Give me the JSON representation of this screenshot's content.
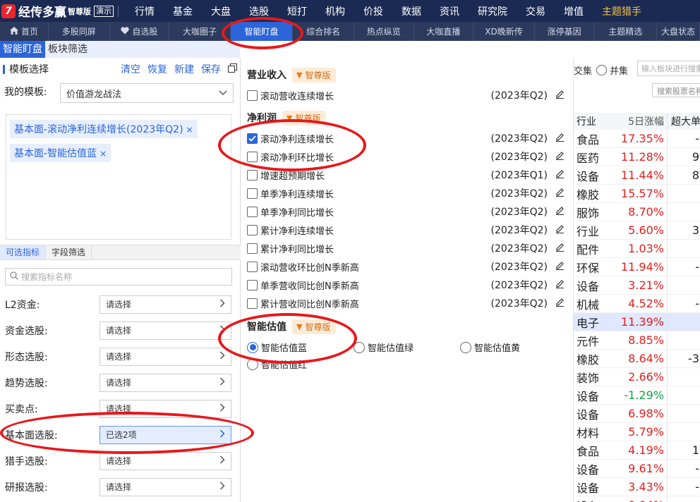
{
  "app": {
    "logo_text": "经传多赢",
    "logo_sub": "智尊版",
    "demo": "演示",
    "logo_mark": "7"
  },
  "top_menu": [
    {
      "label": "行情",
      "dot": false,
      "gold": false
    },
    {
      "label": "基金",
      "dot": false,
      "gold": false
    },
    {
      "label": "大盘",
      "dot": true,
      "gold": false
    },
    {
      "label": "选股",
      "dot": true,
      "gold": false
    },
    {
      "label": "短打",
      "dot": false,
      "gold": false
    },
    {
      "label": "机构",
      "dot": false,
      "gold": false
    },
    {
      "label": "价投",
      "dot": false,
      "gold": false
    },
    {
      "label": "数据",
      "dot": false,
      "gold": false
    },
    {
      "label": "资讯",
      "dot": false,
      "gold": false
    },
    {
      "label": "研究院",
      "dot": false,
      "gold": false
    },
    {
      "label": "交易",
      "dot": false,
      "gold": false
    },
    {
      "label": "增值",
      "dot": true,
      "gold": false
    },
    {
      "label": "主题猎手",
      "dot": false,
      "gold": true
    }
  ],
  "tabs": [
    {
      "label": "首页",
      "icon": "home-icon",
      "active": false
    },
    {
      "label": "多股同屏",
      "icon": "",
      "active": false
    },
    {
      "label": "自选股",
      "icon": "heart-icon",
      "active": false
    },
    {
      "label": "大咖圈子",
      "icon": "",
      "active": false
    },
    {
      "label": "智能盯盘",
      "icon": "",
      "active": true
    },
    {
      "label": "综合排名",
      "icon": "",
      "active": false
    },
    {
      "label": "热点纵览",
      "icon": "",
      "active": false
    },
    {
      "label": "大咖直播",
      "icon": "",
      "active": false
    },
    {
      "label": "XD晚新传",
      "icon": "",
      "active": false
    },
    {
      "label": "涨停基因",
      "icon": "",
      "active": false
    },
    {
      "label": "主题精选",
      "icon": "",
      "active": false
    },
    {
      "label": "大盘状态",
      "icon": "",
      "active": false
    }
  ],
  "side_tabs": [
    {
      "label": "智能盯盘",
      "active": true
    },
    {
      "label": "板块筛选",
      "active": false
    }
  ],
  "template": {
    "title": "模板选择",
    "actions": [
      "清空",
      "恢复",
      "新建",
      "保存"
    ],
    "my_label": "我的模板:",
    "selected": "价值游龙战法",
    "chips": [
      "基本面-滚动净利连续增长(2023年Q2)",
      "基本面-智能估值蓝"
    ],
    "chip_close": "×"
  },
  "subtabs": [
    {
      "label": "可选指标",
      "active": true
    },
    {
      "label": "字段筛选",
      "active": false
    }
  ],
  "search_placeholder": "搜索指标名称",
  "filters": [
    {
      "label": "L2资金:",
      "value": "请选择",
      "selected": false
    },
    {
      "label": "资金选股:",
      "value": "请选择",
      "selected": false
    },
    {
      "label": "形态选股:",
      "value": "请选择",
      "selected": false
    },
    {
      "label": "趋势选股:",
      "value": "请选择",
      "selected": false
    },
    {
      "label": "买卖点:",
      "value": "请选择",
      "selected": false
    },
    {
      "label": "基本面选股:",
      "value": "已选2项",
      "selected": true
    },
    {
      "label": "猎手选股:",
      "value": "请选择",
      "selected": false
    },
    {
      "label": "研报选股:",
      "value": "请选择",
      "selected": false
    }
  ],
  "mid": {
    "revenue_title": "营业收入",
    "badge": "智尊版",
    "revenue_items": [
      {
        "label": "滚动营收连续增长",
        "date": "(2023年Q2)",
        "checked": false
      }
    ],
    "profit_title": "净利润",
    "profit_items": [
      {
        "label": "滚动净利连续增长",
        "date": "(2023年Q2)",
        "checked": true
      },
      {
        "label": "滚动净利环比增长",
        "date": "(2023年Q2)",
        "checked": false
      },
      {
        "label": "增速超预期增长",
        "date": "(2023年Q1)",
        "checked": false
      },
      {
        "label": "单季净利连续增长",
        "date": "(2023年Q2)",
        "checked": false
      },
      {
        "label": "单季净利同比增长",
        "date": "(2023年Q2)",
        "checked": false
      },
      {
        "label": "累计净利连续增长",
        "date": "(2023年Q2)",
        "checked": false
      },
      {
        "label": "累计净利同比增长",
        "date": "(2023年Q2)",
        "checked": false
      },
      {
        "label": "滚动营收环比创N季新高",
        "date": "(2023年Q2)",
        "checked": false
      },
      {
        "label": "单季营收同比创N季新高",
        "date": "(2023年Q2)",
        "checked": false
      },
      {
        "label": "累计营收同比创N季新高",
        "date": "(2023年Q2)",
        "checked": false
      }
    ],
    "valuation_title": "智能估值",
    "valuation_items": [
      {
        "label": "智能估值蓝",
        "checked": true
      },
      {
        "label": "智能估值绿",
        "checked": false
      },
      {
        "label": "智能估值黄",
        "checked": false
      },
      {
        "label": "智能估值红",
        "checked": false
      }
    ]
  },
  "right": {
    "intersect": "交集",
    "union": "并集",
    "sector_search": "输入板块进行搜索",
    "stock_search": "搜索股票名称",
    "headers": [
      "行业",
      "5日涨幅",
      "超大单"
    ],
    "rows": [
      {
        "industry": "食品",
        "change": "17.35%",
        "dir": "up",
        "extra": "-"
      },
      {
        "industry": "医药",
        "change": "11.28%",
        "dir": "up",
        "extra": "9"
      },
      {
        "industry": "设备",
        "change": "11.44%",
        "dir": "up",
        "extra": "8"
      },
      {
        "industry": "橡胶",
        "change": "15.57%",
        "dir": "up",
        "extra": ""
      },
      {
        "industry": "服饰",
        "change": "8.70%",
        "dir": "up",
        "extra": ""
      },
      {
        "industry": "行业",
        "change": "5.60%",
        "dir": "up",
        "extra": "3"
      },
      {
        "industry": "配件",
        "change": "1.03%",
        "dir": "up",
        "extra": ""
      },
      {
        "industry": "环保",
        "change": "11.94%",
        "dir": "up",
        "extra": "-"
      },
      {
        "industry": "设备",
        "change": "3.21%",
        "dir": "up",
        "extra": ""
      },
      {
        "industry": "机械",
        "change": "4.52%",
        "dir": "up",
        "extra": "-"
      },
      {
        "industry": "电子",
        "change": "11.39%",
        "dir": "up",
        "extra": "",
        "hl": true
      },
      {
        "industry": "元件",
        "change": "8.85%",
        "dir": "up",
        "extra": ""
      },
      {
        "industry": "橡胶",
        "change": "8.64%",
        "dir": "up",
        "extra": "-3"
      },
      {
        "industry": "装饰",
        "change": "2.66%",
        "dir": "up",
        "extra": ""
      },
      {
        "industry": "设备",
        "change": "-1.29%",
        "dir": "down",
        "extra": ""
      },
      {
        "industry": "设备",
        "change": "6.98%",
        "dir": "up",
        "extra": ""
      },
      {
        "industry": "材料",
        "change": "5.79%",
        "dir": "up",
        "extra": ""
      },
      {
        "industry": "食品",
        "change": "4.19%",
        "dir": "up",
        "extra": "1"
      },
      {
        "industry": "设备",
        "change": "9.61%",
        "dir": "up",
        "extra": "-"
      },
      {
        "industry": "设备",
        "change": "3.43%",
        "dir": "up",
        "extra": "-"
      },
      {
        "industry": "设备",
        "change": "0.04%",
        "dir": "up",
        "extra": ""
      }
    ]
  },
  "colors": {
    "accent": "#2b65d9",
    "up": "#e02020",
    "down": "#16a044",
    "annotation": "#e8171b",
    "topbar": "#1b2a52"
  }
}
